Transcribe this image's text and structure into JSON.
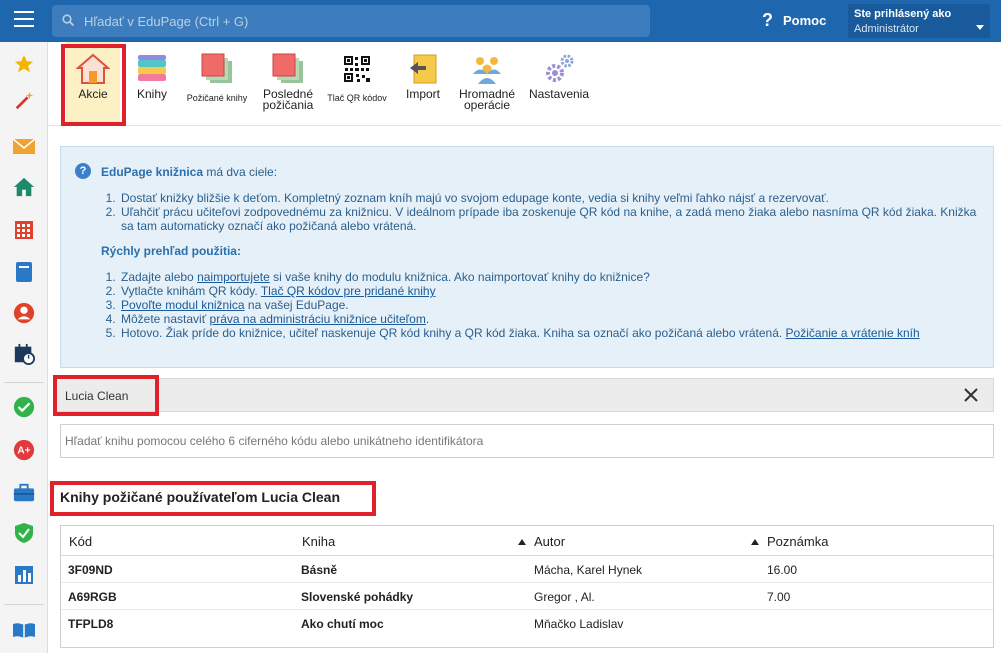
{
  "topbar": {
    "search_placeholder": "Hľadať v EduPage (Ctrl + G)",
    "help_label": "Pomoc",
    "user_status": "Ste prihlásený ako",
    "user_role": "Administrátor"
  },
  "toolbar": {
    "akcie": "Akcie",
    "knihy": "Knihy",
    "pozicane": "Požičané knihy",
    "posledne_1": "Posledné",
    "posledne_2": "požičania",
    "tlac_qr": "Tlač QR kódov",
    "import": "Import",
    "hromadne_1": "Hromadné",
    "hromadne_2": "operácie",
    "nastavenia": "Nastavenia"
  },
  "info": {
    "title_bold": "EduPage knižnica",
    "title_rest": " má dva ciele:",
    "goals": [
      "Dostať knižky bližšie k deťom. Kompletný zoznam kníh majú vo svojom edupage konte, vedia si knihy veľmi ľahko nájsť a rezervovať.",
      "Uľahčiť prácu učiteľovi zodpovednému za knižnicu. V ideálnom prípade iba zoskenuje QR kód na knihe, a zadá meno žiaka alebo nasníma QR kód žiaka. Knižka sa tam automaticky označí ako požičaná alebo vrátená."
    ],
    "quick_title": "Rýchly prehľad použitia:",
    "s1_a": "Zadajte alebo ",
    "s1_link": "naimportujete",
    "s1_b": " si vaše knihy do modulu knižnica. Ako naimportovať knihy do knižnice?",
    "s2_a": "Vytlačte knihám QR kódy. ",
    "s2_link": "Tlač QR kódov pre pridané knihy",
    "s3_link": "Povoľte modul knižnica",
    "s3_b": " na vašej EduPage.",
    "s4_a": "Môžete nastaviť ",
    "s4_link": "práva na administráciu knižnice učiteľom",
    "s4_b": ".",
    "s5_a": "Hotovo. Žiak príde do knižnice, učiteľ naskenuje QR kód knihy a QR kód žiaka. Kniha sa označí ako požičaná alebo vrátená. ",
    "s5_link": "Požičanie a vrátenie kníh"
  },
  "namebar": {
    "name": "Lucia  Clean"
  },
  "code_search": {
    "placeholder": "Hľadať knihu pomocou celého 6 ciferného kódu alebo unikátneho identifikátora"
  },
  "section_title": "Knihy požičané používateľom Lucia Clean",
  "table": {
    "headers": {
      "kod": "Kód",
      "kniha": "Kniha",
      "autor": "Autor",
      "poznamka": "Poznámka"
    },
    "rows": [
      {
        "kod": "3F09ND",
        "kniha": "Básně",
        "autor": "Mácha, Karel Hynek",
        "poznamka": "16.00"
      },
      {
        "kod": "A69RGB",
        "kniha": "Slovenské pohádky",
        "autor": "Gregor , Al.",
        "poznamka": "7.00"
      },
      {
        "kod": "TFPLD8",
        "kniha": "Ako chutí moc",
        "autor": "Mňačko Ladislav",
        "poznamka": ""
      }
    ]
  },
  "colors": {
    "topbar": "#1e66ad",
    "highlight": "#e0212b",
    "info_bg": "#e6f0f8"
  }
}
